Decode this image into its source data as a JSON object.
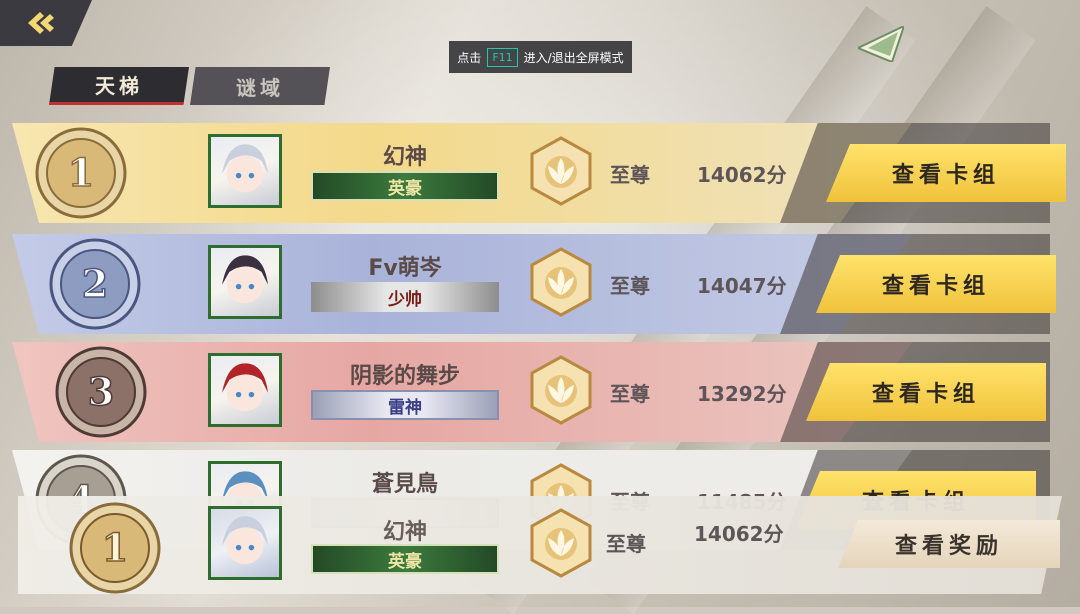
{
  "hint": {
    "prefix": "点击",
    "key": "F11",
    "suffix": "进入/退出全屏模式"
  },
  "tabs": [
    {
      "label": "天梯",
      "active": true
    },
    {
      "label": "谜域",
      "active": false
    }
  ],
  "rows": [
    {
      "rank": "1",
      "name": "幻神",
      "title": "英豪",
      "title_style": "green",
      "tier": "至尊",
      "score": "14062分",
      "button": "查看卡组",
      "band_color": "#f3d98a",
      "avatar_hair": "#c9cfdc"
    },
    {
      "rank": "2",
      "name": "Fv萌岑",
      "title": "少帅",
      "title_style": "grey",
      "tier": "至尊",
      "score": "14047分",
      "button": "查看卡组",
      "band_color": "#a9b3d9",
      "avatar_hair": "#3a3040"
    },
    {
      "rank": "3",
      "name": "阴影的舞步",
      "title": "雷神",
      "title_style": "silver",
      "tier": "至尊",
      "score": "13292分",
      "button": "查看卡组",
      "band_color": "#e6a7a3",
      "avatar_hair": "#b3232a"
    },
    {
      "rank": "4",
      "name": "蒼見鳥",
      "title": "",
      "title_style": "silver",
      "tier": "至尊",
      "score": "11485分",
      "button": "查看卡组",
      "band_color": "#ecebe8",
      "avatar_hair": "#5a8fbf"
    }
  ],
  "own": {
    "rank": "1",
    "name": "幻神",
    "title": "英豪",
    "tier": "至尊",
    "score": "14062分",
    "button": "查看奖励"
  },
  "colors": {
    "accent_red": "#c23030",
    "deck_button": "#f0c23b",
    "green_title": "#3c7a3e"
  },
  "icons": {
    "back": "back-arrow-icon",
    "corner": "triangle-icon",
    "tier": "lotus-hexagon-icon"
  }
}
